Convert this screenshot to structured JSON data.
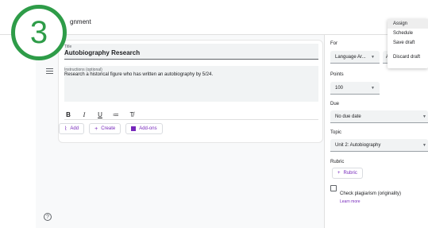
{
  "app": {
    "title": "Assignment",
    "title_partial": "gnment",
    "step_number": "3"
  },
  "form": {
    "title_label": "Title",
    "title_value": "Autobiography Research",
    "instructions_label": "Instructions (optional)",
    "instructions_value": "Research a historical figure who has written an autobiography by 5/24."
  },
  "format_toolbar": {
    "bold": "B",
    "italic": "I",
    "underline": "U",
    "list": "≔",
    "clear": "T̸"
  },
  "attachments": {
    "add_label": "Add",
    "create_label": "Create",
    "addons_label": "Add-ons"
  },
  "sidebar": {
    "for_label": "For",
    "class_value": "Language Ar...",
    "students_partial": "A",
    "points_label": "Points",
    "points_value": "100",
    "due_label": "Due",
    "due_value": "No due date",
    "topic_label": "Topic",
    "topic_value": "Unit 2: Autobiography",
    "rubric_label": "Rubric",
    "rubric_button": "Rubric",
    "plagiarism_label": "Check plagiarism (originality)",
    "learn_more": "Learn more"
  },
  "assign_menu": {
    "items": [
      "Assign",
      "Schedule",
      "Save draft",
      "Discard draft"
    ]
  },
  "colors": {
    "accent": "#7627bb",
    "badge": "#2e9c48"
  }
}
